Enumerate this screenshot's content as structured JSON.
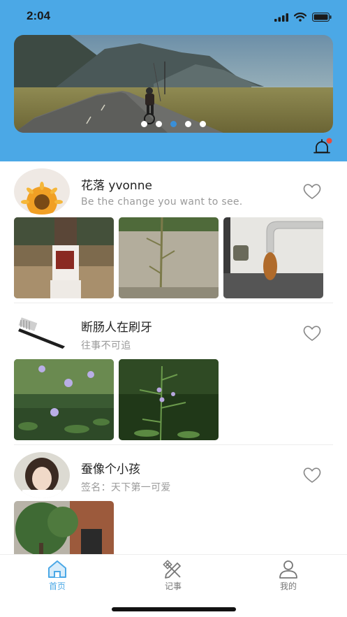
{
  "status_bar": {
    "time": "2:04",
    "icons": [
      "cellular-signal-icon",
      "wifi-icon",
      "battery-icon"
    ]
  },
  "banner": {
    "image": "road-mountain-cyclist-photo",
    "page_count": 5,
    "active_page": 3
  },
  "header": {
    "notification_icon": "bell-icon",
    "has_unread_badge": true,
    "badge_color": "#e94b3c"
  },
  "posts": [
    {
      "username": "花落 yvonne",
      "signature": "Be the change you want to see.",
      "avatar": "sunflower-avatar",
      "liked": false,
      "photos": [
        "tree-trunk-photo",
        "wall-plant-photo",
        "faucet-photo"
      ]
    },
    {
      "username": "断肠人在刷牙",
      "signature": "往事不可追",
      "avatar": "toothbrush-avatar",
      "liked": false,
      "photos": [
        "blue-flowers-photo",
        "flower-stem-photo"
      ]
    },
    {
      "username": "蚕像个小孩",
      "signature": "签名：天下第一可爱",
      "avatar": "girl-portrait-avatar",
      "liked": false,
      "photos": [
        "tree-building-photo"
      ]
    }
  ],
  "tabbar": {
    "tabs": [
      {
        "label": "首页",
        "icon": "home-icon",
        "active": true
      },
      {
        "label": "记事",
        "icon": "pencil-ruler-icon",
        "active": false
      },
      {
        "label": "我的",
        "icon": "person-icon",
        "active": false
      }
    ]
  },
  "colors": {
    "header_bg": "#4ba8e6",
    "accent": "#4ba8e6",
    "text_primary": "#222222",
    "text_secondary": "#9a9a9a"
  }
}
